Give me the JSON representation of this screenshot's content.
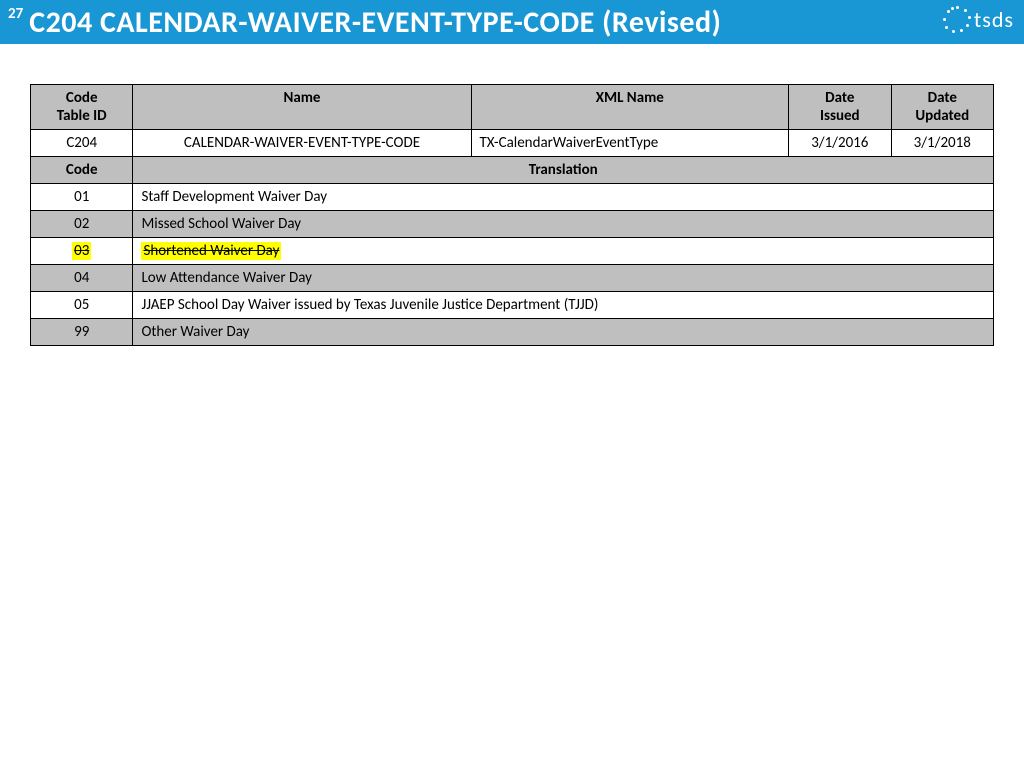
{
  "header": {
    "page_number": "27",
    "title": "C204 CALENDAR-WAIVER-EVENT-TYPE-CODE (Revised)",
    "logo_text": "tsds"
  },
  "meta_table": {
    "headers": {
      "code_table_id": "Code\nTable ID",
      "name": "Name",
      "xml_name": "XML Name",
      "date_issued": "Date\nIssued",
      "date_updated": "Date\nUpdated"
    },
    "row": {
      "code_table_id": "C204",
      "name": "CALENDAR-WAIVER-EVENT-TYPE-CODE",
      "xml_name": "TX-CalendarWaiverEventType",
      "date_issued": "3/1/2016",
      "date_updated": "3/1/2018"
    }
  },
  "code_table": {
    "headers": {
      "code": "Code",
      "translation": "Translation"
    },
    "rows": [
      {
        "code": "01",
        "translation": "Staff Development Waiver Day",
        "alt": false,
        "struck": false
      },
      {
        "code": "02",
        "translation": "Missed School Waiver Day",
        "alt": true,
        "struck": false
      },
      {
        "code": "03",
        "translation": "Shortened Waiver Day",
        "alt": false,
        "struck": true
      },
      {
        "code": "04",
        "translation": "Low Attendance Waiver Day",
        "alt": true,
        "struck": false
      },
      {
        "code": "05",
        "translation": "JJAEP School Day Waiver issued by Texas Juvenile Justice Department (TJJD)",
        "alt": false,
        "struck": false
      },
      {
        "code": "99",
        "translation": "Other Waiver Day",
        "alt": true,
        "struck": false
      }
    ]
  }
}
